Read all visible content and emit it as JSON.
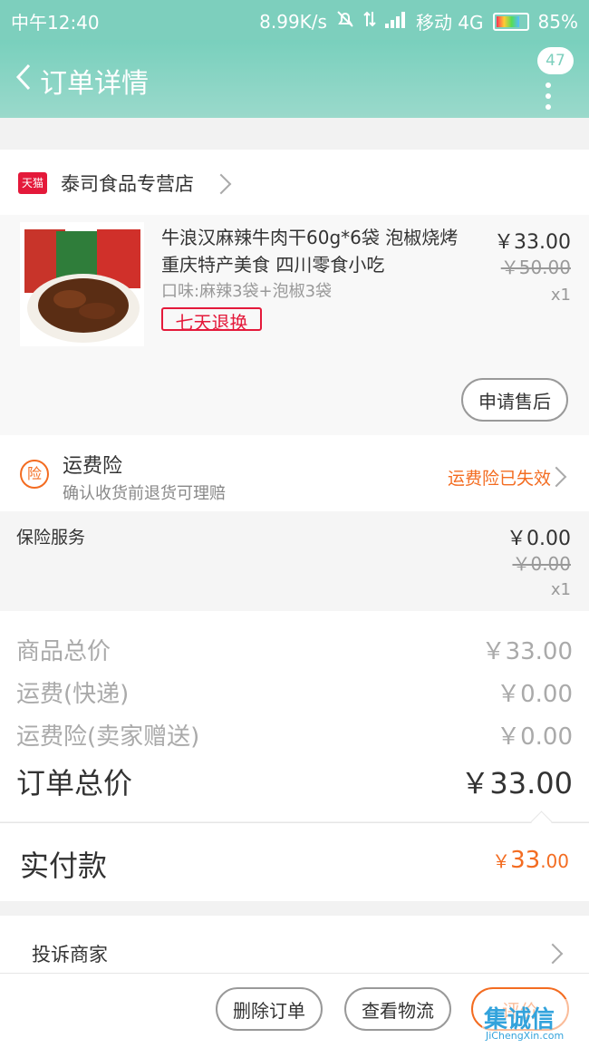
{
  "status_bar": {
    "time": "中午12:40",
    "network_speed": "8.99K/s",
    "carrier": "移动 4G",
    "battery": "85%"
  },
  "nav": {
    "title": "订单详情",
    "badge_count": "47"
  },
  "store": {
    "platform_tag": "天猫",
    "name": "泰司食品专营店"
  },
  "item": {
    "name": "牛浪汉麻辣牛肉干60g*6袋 泡椒烧烤 重庆特产美食 四川零食小吃",
    "sku": "口味:麻辣3袋+泡椒3袋",
    "tag": "七天退换",
    "price": "￥33.00",
    "original_price": "￥50.00",
    "quantity": "x1",
    "after_sale_button": "申请售后"
  },
  "shipping_insurance": {
    "icon_text": "险",
    "label": "运费险",
    "description": "确认收货前退货可理赔",
    "status": "运费险已失效"
  },
  "insurance_service": {
    "label": "保险服务",
    "price": "￥0.00",
    "original_price": "￥0.00",
    "quantity": "x1"
  },
  "summary": {
    "goods_total_label": "商品总价",
    "goods_total_value": "￥33.00",
    "shipping_label": "运费(快递)",
    "shipping_value": "￥0.00",
    "insurance_label": "运费险(卖家赠送)",
    "insurance_value": "￥0.00",
    "order_total_label": "订单总价",
    "order_total_value": "￥33.00"
  },
  "paid": {
    "label": "实付款",
    "currency": "￥",
    "amount_int": "33",
    "amount_dec": ".00"
  },
  "complain": {
    "label": "投诉商家"
  },
  "actions": {
    "delete_order": "删除订单",
    "view_logistics": "查看物流",
    "review": "评价"
  },
  "watermark": {
    "brand": "集诚信",
    "url": "JiChengXin.com"
  },
  "colors": {
    "header": "#7dcfbd",
    "accent_orange": "#f36c21",
    "tmall_red": "#e4193a"
  }
}
